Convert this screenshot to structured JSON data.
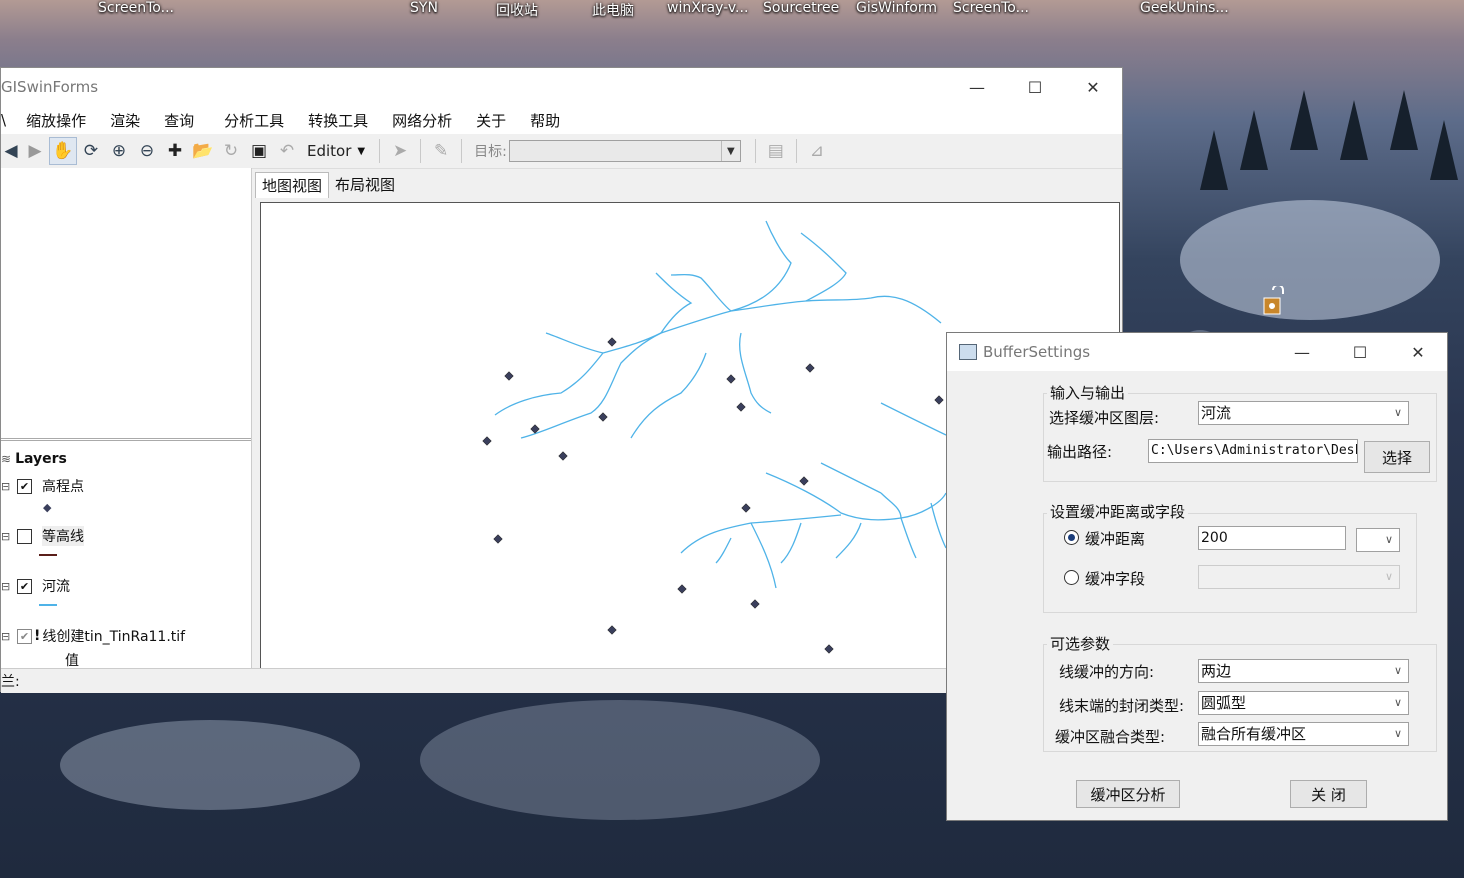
{
  "desktop": {
    "icons": [
      "ScreenTo...",
      "SYN",
      "回收站",
      "此电脑",
      "winXray-v...",
      "Sourcetree",
      "GisWinform",
      "ScreenTo...",
      "GeekUnins..."
    ]
  },
  "main_window": {
    "title": "GISwinForms",
    "menu": [
      "\\",
      "缩放操作",
      "渲染",
      "查询",
      "分析工具",
      "转换工具",
      "网络分析",
      "关于",
      "帮助"
    ],
    "toolbar": {
      "editor_label": "Editor",
      "target_label": "目标:",
      "target_value": ""
    },
    "tabs": [
      "地图视图",
      "布局视图"
    ],
    "toc": {
      "root": "Layers",
      "layers": [
        {
          "name": "高程点",
          "checked": true
        },
        {
          "name": "等高线",
          "checked": false
        },
        {
          "name": "河流",
          "checked": true
        },
        {
          "name": "线创建tin_TinRa11.tif",
          "checked": true,
          "sub": "值"
        }
      ]
    },
    "status": "兰:"
  },
  "dialog": {
    "title": "BufferSettings",
    "io_group": "输入与输出",
    "layer_label": "选择缓冲区图层:",
    "layer_value": "河流",
    "output_label": "输出路径:",
    "output_value": "C:\\Users\\Administrator\\Desk",
    "choose_button": "选择",
    "dist_group": "设置缓冲距离或字段",
    "radio_distance": "缓冲距离",
    "distance_value": "200",
    "unit_value": "",
    "radio_field": "缓冲字段",
    "field_value": "",
    "opt_group": "可选参数",
    "side_label": "线缓冲的方向:",
    "side_value": "两边",
    "end_label": "线末端的封闭类型:",
    "end_value": "圆弧型",
    "dissolve_label": "缓冲区融合类型:",
    "dissolve_value": "融合所有缓冲区",
    "analyze_button": "缓冲区分析",
    "close_button": "关 闭"
  },
  "colors": {
    "river": "#4fb3e8",
    "point": "#3a3f5c"
  }
}
